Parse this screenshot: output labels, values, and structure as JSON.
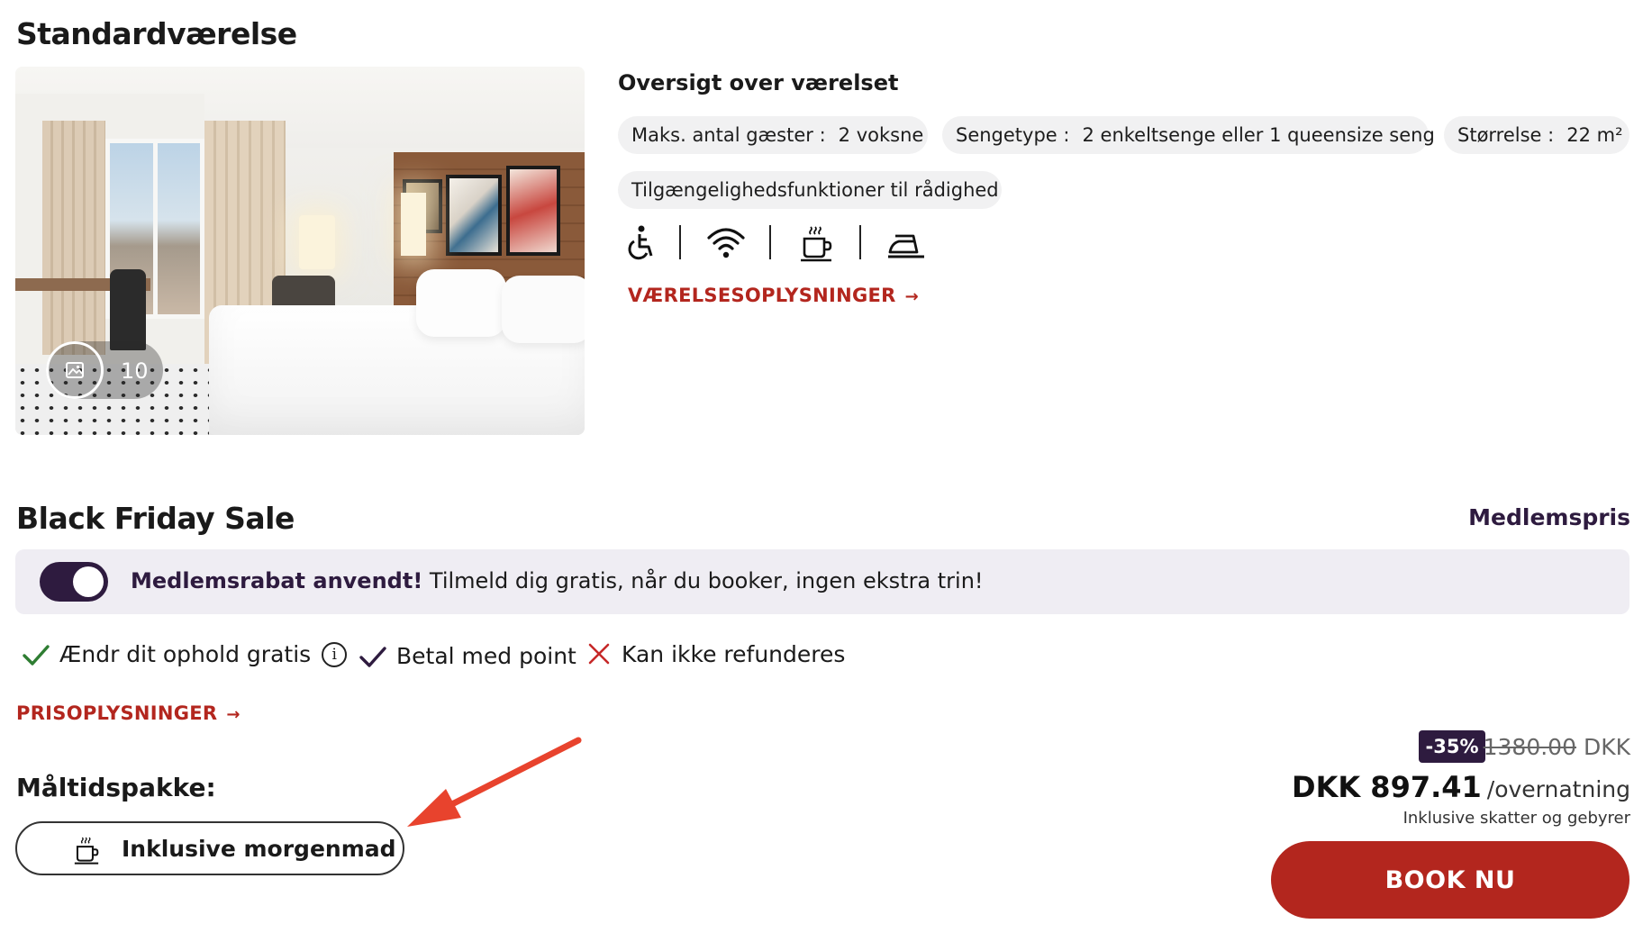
{
  "room": {
    "title": "Standardværelse",
    "photo_count": "10"
  },
  "overview": {
    "title": "Oversigt over værelset",
    "max_guests_label": "Maks. antal gæster :",
    "max_guests_value": "2 voksne",
    "bed_type_label": "Sengetype :",
    "bed_type_value": "2 enkeltsenge eller 1 queensize seng",
    "size_label": "Størrelse :",
    "size_value": "22 m²",
    "accessibility_label": "Tilgængelighedsfunktioner til rådighed",
    "amenity_icons": [
      "accessibility-icon",
      "wifi-icon",
      "coffee-icon",
      "iron-icon"
    ],
    "details_link": "VÆRELSESOPLYSNINGER"
  },
  "rate": {
    "title": "Black Friday Sale",
    "member_price_label": "Medlemspris",
    "banner_bold": "Medlemsrabat anvendt!",
    "banner_text": " Tilmeld dig gratis, når du booker, ingen ekstra trin!",
    "toggle_on": true,
    "features": [
      {
        "label": "Ændr dit ophold gratis",
        "status": "included"
      },
      {
        "label": "Betal med point",
        "status": "included"
      },
      {
        "label": "Kan ikke refunderes",
        "status": "excluded"
      }
    ],
    "info_glyph": "i",
    "price_details_link": "PRISOPLYSNINGER",
    "meal_title": "Måltidspakke:",
    "meal_option": "Inklusive morgenmad"
  },
  "pricing": {
    "discount": "-35%",
    "old_price": "1380.00",
    "old_currency": "DKK",
    "new_price": "DKK 897.41",
    "per_night": "/overnatning",
    "tax_note": "Inklusive skatter og gebyrer",
    "book_label": "BOOK NU"
  },
  "colors": {
    "accent_red": "#b3261e",
    "brand_purple": "#2e1b3f",
    "check_green": "#2e7d32",
    "annotation_arrow": "#e8432d"
  }
}
